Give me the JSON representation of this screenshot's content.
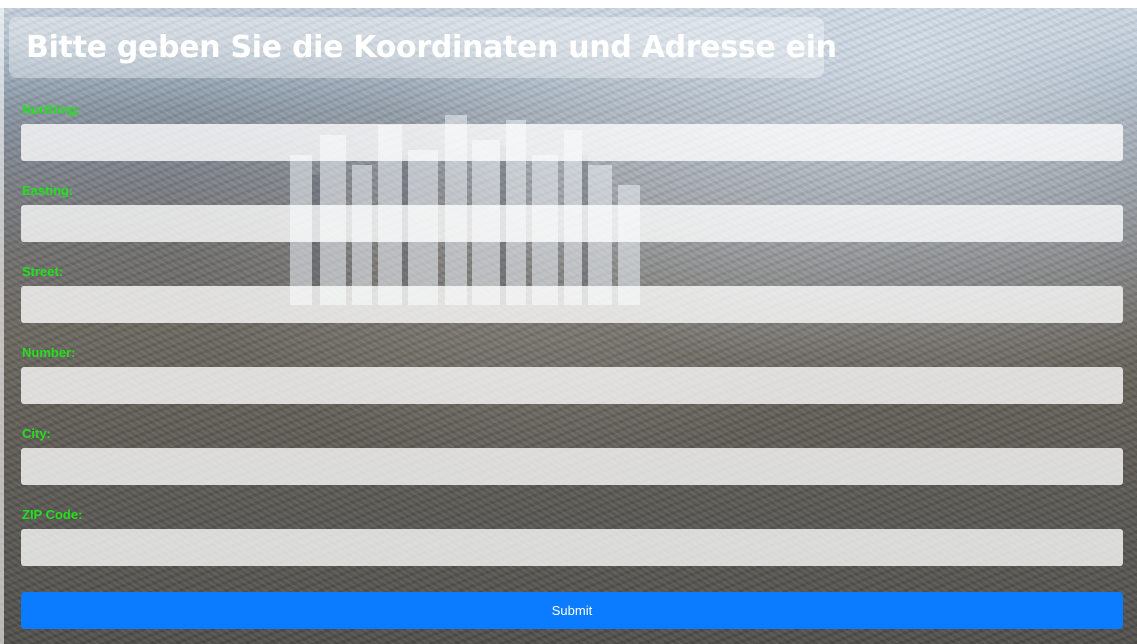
{
  "page": {
    "title": "Bitte geben Sie die Koordinaten und Adresse ein"
  },
  "form": {
    "fields": [
      {
        "label": "Northing:",
        "value": ""
      },
      {
        "label": "Easting:",
        "value": ""
      },
      {
        "label": "Street:",
        "value": ""
      },
      {
        "label": "Number:",
        "value": ""
      },
      {
        "label": "City:",
        "value": ""
      },
      {
        "label": "ZIP Code:",
        "value": ""
      }
    ],
    "submit_label": "Submit"
  },
  "colors": {
    "label": "#22e01a",
    "submit": "#0b7bff",
    "title_text": "#ffffff"
  }
}
